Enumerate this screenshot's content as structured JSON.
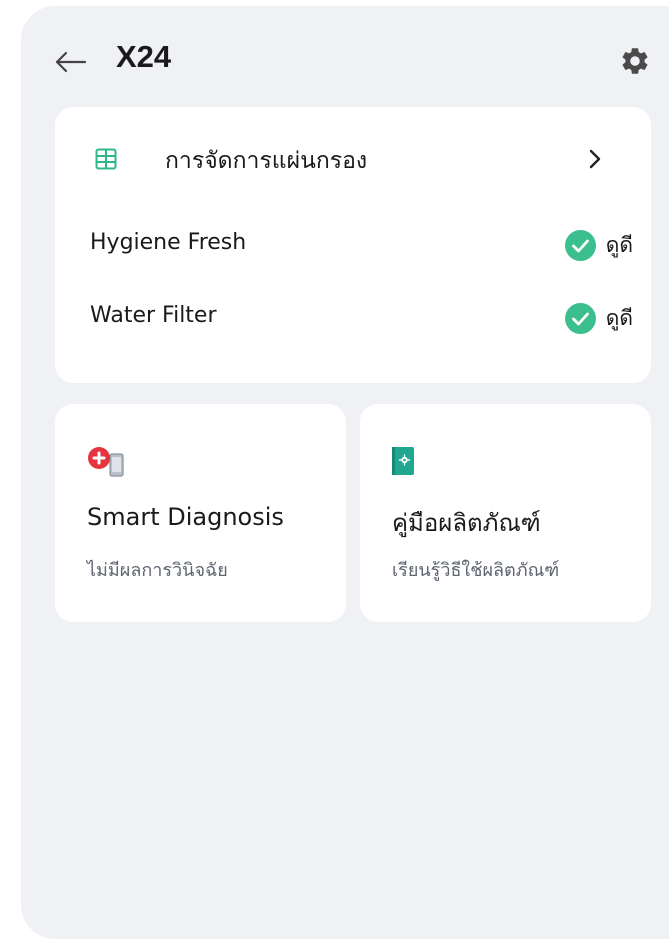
{
  "header": {
    "title": "X24"
  },
  "filter": {
    "title": "การจัดการแผ่นกรอง",
    "items": [
      {
        "label": "Hygiene Fresh",
        "status": "ดูดี"
      },
      {
        "label": "Water Filter",
        "status": "ดูดี"
      }
    ]
  },
  "tiles": {
    "diagnosis": {
      "title": "Smart Diagnosis",
      "subtitle": "ไม่มีผลการวินิจฉัย"
    },
    "manual": {
      "title": "คู่มือผลิตภัณฑ์",
      "subtitle": "เรียนรู้วิธีใช้ผลิตภัณฑ์"
    }
  },
  "colors": {
    "accent_green": "#3cbf8f",
    "alert_red": "#e5333f",
    "background": "#eff1f5",
    "card": "#ffffff"
  },
  "icons": {
    "back": "arrow-left-icon",
    "settings": "gear-icon",
    "filter": "grid-icon",
    "status": "check-circle-icon",
    "diagnosis": "diagnosis-phone-icon",
    "manual": "manual-book-icon"
  }
}
